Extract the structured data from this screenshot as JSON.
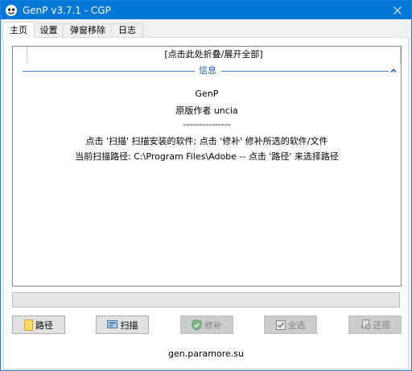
{
  "window": {
    "title": "GenP v3.7.1 - CGP"
  },
  "tabs": [
    {
      "label": "主页"
    },
    {
      "label": "设置"
    },
    {
      "label": "弹窗移除"
    },
    {
      "label": "日志"
    }
  ],
  "main": {
    "collapse_label": "[点击此处折叠/展开全部]",
    "section_title": "信息",
    "info_lines": [
      "GenP",
      "原版作者 uncia",
      "---------------",
      "点击 '扫描' 扫描安装的软件; 点击 '修补' 修补所选的软件/文件",
      "当前扫描路径: C:\\Program Files\\Adobe -- 点击 '路径' 来选择路径"
    ],
    "progress_fraction": 0
  },
  "buttons": {
    "path": "路径",
    "scan": "扫描",
    "patch": "修补",
    "select_all": "全选",
    "restore": "还原"
  },
  "icons": {
    "app": "genp-app-icon",
    "close": "close-icon",
    "chevron": "chevron-up-icon",
    "path": "folder-icon",
    "scan": "scan-icon",
    "patch": "shield-check-icon",
    "select_all": "checkbox-icon",
    "restore": "restore-icon"
  },
  "footer": {
    "url": "gen.paramore.su"
  },
  "colors": {
    "titlebar": "#0078d7",
    "section_accent": "#1a5fb4"
  }
}
